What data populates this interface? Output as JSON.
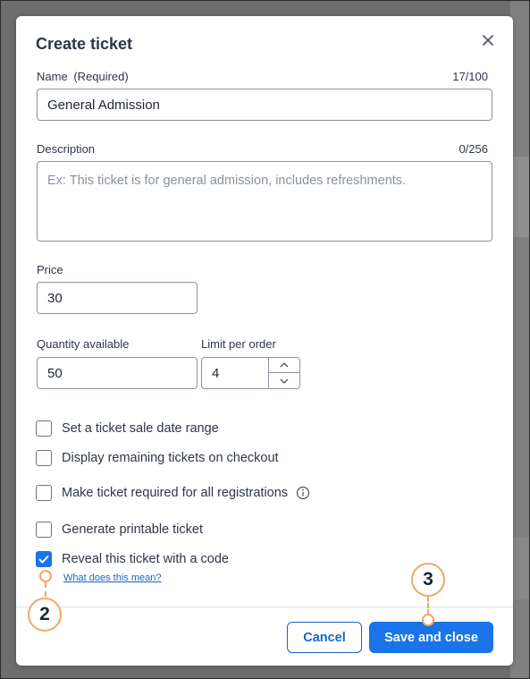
{
  "modal": {
    "title": "Create ticket",
    "close_icon": "close-icon"
  },
  "name": {
    "label": "Name",
    "required": "(Required)",
    "counter": "17/100",
    "value": "General Admission"
  },
  "description": {
    "label": "Description",
    "counter": "0/256",
    "placeholder": "Ex: This ticket is for general admission, includes refreshments.",
    "value": ""
  },
  "price": {
    "label": "Price",
    "value": "30"
  },
  "quantity": {
    "label": "Quantity available",
    "value": "50"
  },
  "limit": {
    "label": "Limit per order",
    "value": "4"
  },
  "options": [
    {
      "label": "Set a ticket sale date range",
      "checked": false
    },
    {
      "label": "Display remaining tickets on checkout",
      "checked": false
    },
    {
      "label": "Make ticket required for all registrations",
      "checked": false,
      "info_icon": "info-icon"
    },
    {
      "label": "Generate printable ticket",
      "checked": false
    },
    {
      "label": "Reveal this ticket with a code",
      "checked": true
    }
  ],
  "help_link": "What does this mean?",
  "footer": {
    "cancel_label": "Cancel",
    "save_label": "Save and close"
  },
  "callouts": {
    "step2": "2",
    "step3": "3",
    "color": "#f4a661"
  },
  "colors": {
    "primary": "#1a73e8",
    "text": "#2e3646"
  }
}
